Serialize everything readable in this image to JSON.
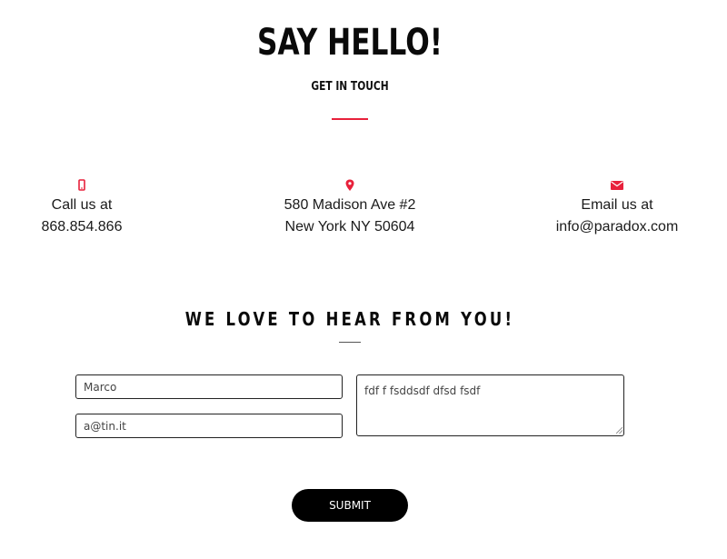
{
  "hero": {
    "title": "SAY HELLO!",
    "subtitle": "GET IN TOUCH"
  },
  "contacts": [
    {
      "icon": "mobile-phone-icon",
      "line1": "Call us at",
      "line2": "868.854.866"
    },
    {
      "icon": "map-pin-icon",
      "line1": "580 Madison Ave #2",
      "line2": "New York NY 50604"
    },
    {
      "icon": "envelope-icon",
      "line1": "Email us at",
      "line2": "info@paradox.com"
    }
  ],
  "form": {
    "heading": "WE LOVE TO HEAR FROM YOU!",
    "name_value": "Marco",
    "email_value": "a@tin.it",
    "message_value": "fdf f fsddsdf dfsd fsdf",
    "submit_label": "SUBMIT"
  },
  "colors": {
    "accent": "#e8213b",
    "button": "#000000",
    "text": "#111111"
  }
}
